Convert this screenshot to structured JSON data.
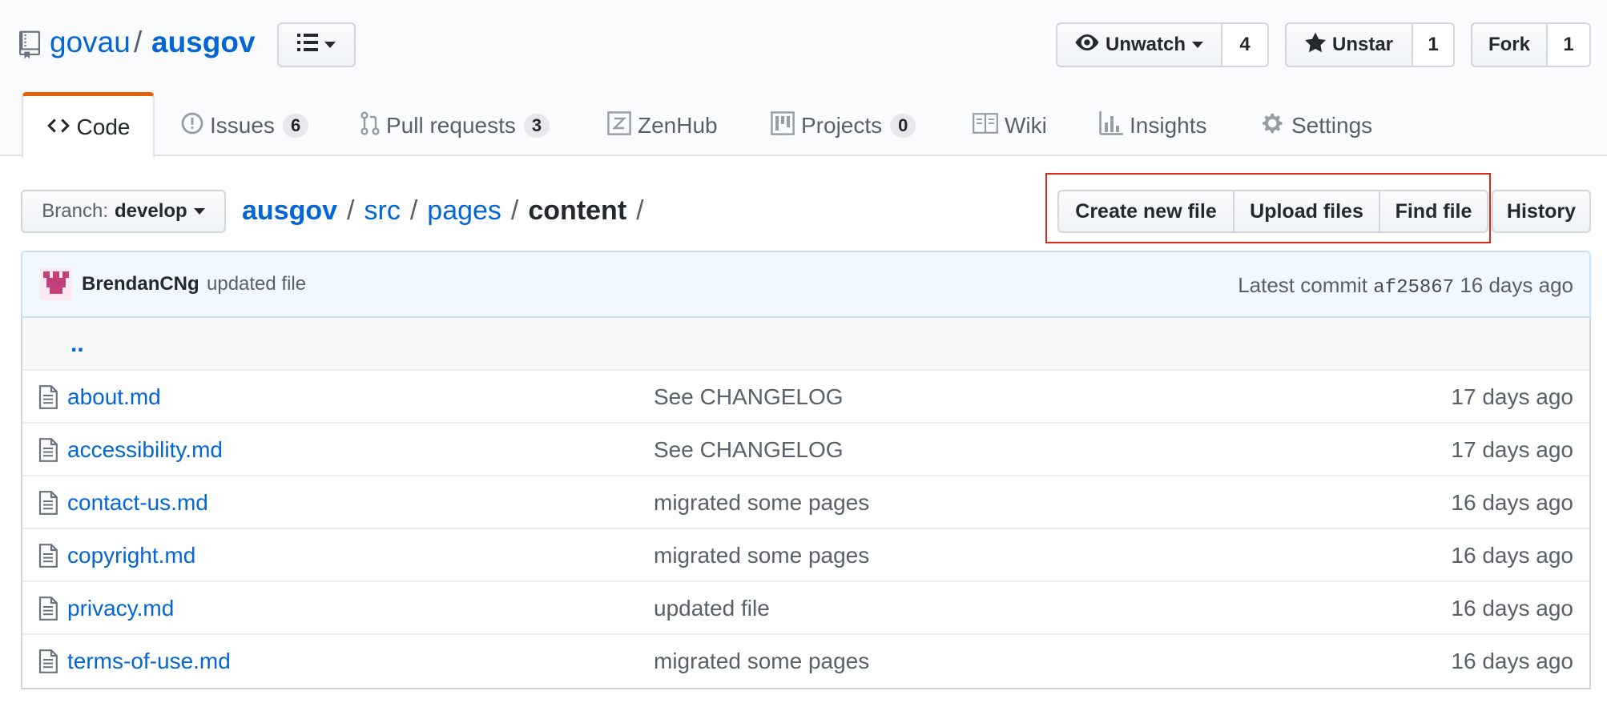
{
  "repo": {
    "owner": "govau",
    "separator": "/",
    "name": "ausgov"
  },
  "actions": {
    "watch": {
      "label": "Unwatch",
      "count": "4"
    },
    "star": {
      "label": "Unstar",
      "count": "1"
    },
    "fork": {
      "label": "Fork",
      "count": "1"
    }
  },
  "tabs": [
    {
      "label": "Code",
      "icon": "code-icon"
    },
    {
      "label": "Issues",
      "count": "6",
      "icon": "issue-icon"
    },
    {
      "label": "Pull requests",
      "count": "3",
      "icon": "pull-request-icon"
    },
    {
      "label": "ZenHub",
      "icon": "zenhub-icon"
    },
    {
      "label": "Projects",
      "count": "0",
      "icon": "project-icon"
    },
    {
      "label": "Wiki",
      "icon": "book-icon"
    },
    {
      "label": "Insights",
      "icon": "graph-icon"
    },
    {
      "label": "Settings",
      "icon": "gear-icon"
    }
  ],
  "branch": {
    "prefix": "Branch:",
    "name": "develop"
  },
  "breadcrumb": {
    "parts": [
      "ausgov",
      "src",
      "pages"
    ],
    "current": "content",
    "separator": "/"
  },
  "file_actions": {
    "create": "Create new file",
    "upload": "Upload files",
    "find": "Find file",
    "history": "History"
  },
  "commit": {
    "author": "BrendanCNg",
    "message": "updated file",
    "prefix": "Latest commit",
    "sha": "af25867",
    "age": "16 days ago"
  },
  "parent_dir": "..",
  "files": [
    {
      "name": "about.md",
      "message": "See CHANGELOG",
      "age": "17 days ago"
    },
    {
      "name": "accessibility.md",
      "message": "See CHANGELOG",
      "age": "17 days ago"
    },
    {
      "name": "contact-us.md",
      "message": "migrated some pages",
      "age": "16 days ago"
    },
    {
      "name": "copyright.md",
      "message": "migrated some pages",
      "age": "16 days ago"
    },
    {
      "name": "privacy.md",
      "message": "updated file",
      "age": "16 days ago"
    },
    {
      "name": "terms-of-use.md",
      "message": "migrated some pages",
      "age": "16 days ago"
    }
  ],
  "colors": {
    "link": "#0366d6",
    "tab_accent": "#e36209",
    "highlight": "#e0261c",
    "commit_bg": "#f1f8ff"
  }
}
